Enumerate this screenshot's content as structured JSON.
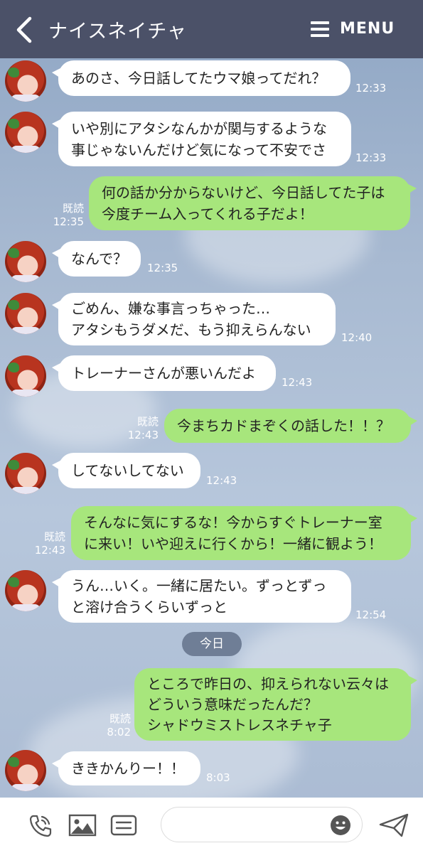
{
  "header": {
    "contact_name": "ナイスネイチャ",
    "menu_label": "MENU"
  },
  "messages": [
    {
      "text": "あのさ、今日話してたウマ娘ってだれ？",
      "time": "12:33"
    },
    {
      "text": "いや別にアタシなんかが関与するような\n事じゃないんだけど気になって不安でさ",
      "time": "12:33"
    },
    {
      "text": "何の話か分からないけど、今日話してた子は\n今度チーム入ってくれる子だよ！",
      "read": "既読",
      "time": "12:35"
    },
    {
      "text": "なんで？",
      "time": "12:35"
    },
    {
      "text": "ごめん、嫌な事言っちゃった…\nアタシもうダメだ、もう抑えらんない",
      "time": "12:40"
    },
    {
      "text": "トレーナーさんが悪いんだよ",
      "time": "12:43"
    },
    {
      "text": "今まちカドまぞくの話した！！？",
      "read": "既読",
      "time": "12:43"
    },
    {
      "text": "してないしてない",
      "time": "12:43"
    },
    {
      "text": "そんなに気にするな！今からすぐトレーナー室\nに来い！いや迎えに行くから！一緒に観よう！",
      "read": "既読",
      "time": "12:43"
    },
    {
      "text": "うん…いく。一緒に居たい。ずっとずっ\nと溶け合うくらいずっと",
      "time": "12:54"
    },
    {
      "text": "ところで昨日の、抑えられない云々は\nどういう意味だったんだ？\nシャドウミストレスネチャ子",
      "read": "既読",
      "time": "8:02"
    },
    {
      "text": "ききかんりー！！",
      "time": "8:03"
    }
  ],
  "date_separator": "今日",
  "composer": {
    "placeholder": ""
  },
  "colors": {
    "header": "#4b5168",
    "outgoing_bubble": "#a7e67c",
    "incoming_bubble": "#ffffff"
  }
}
